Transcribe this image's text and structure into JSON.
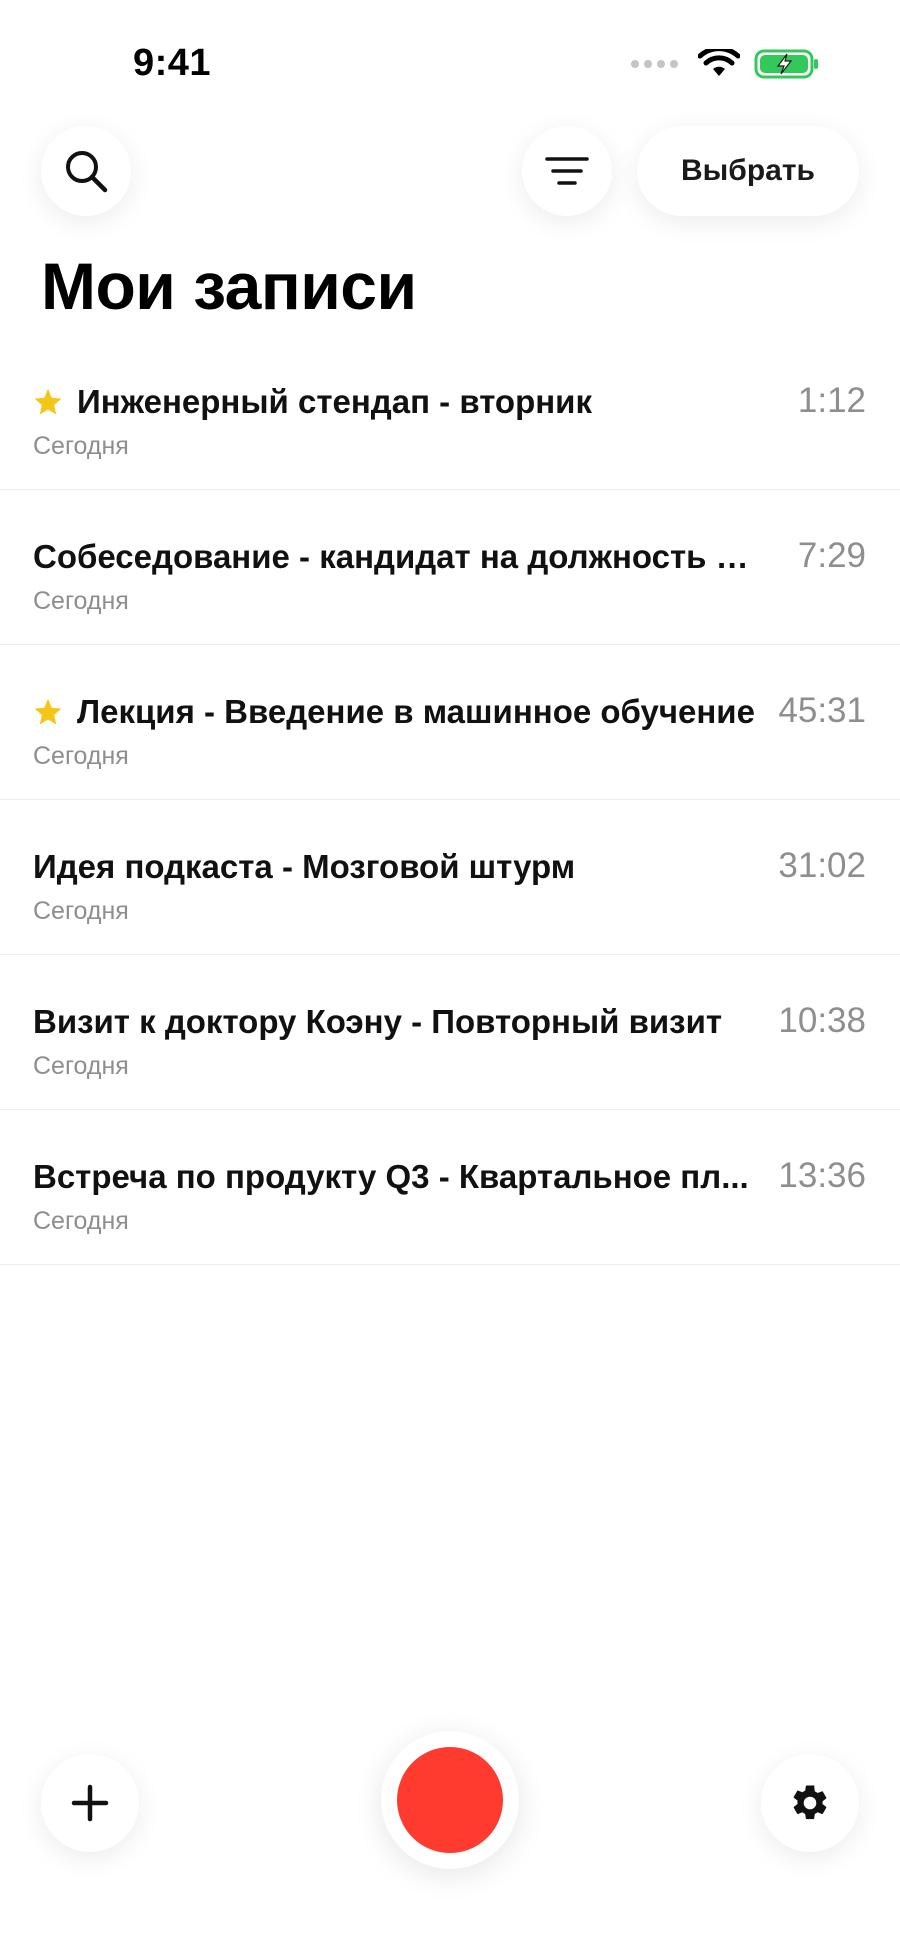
{
  "status_bar": {
    "time": "9:41"
  },
  "header": {
    "select_label": "Выбрать",
    "title": "Мои записи"
  },
  "icons": {
    "search": "search-icon",
    "filter": "filter-icon",
    "star": "star-icon",
    "add": "plus-icon",
    "settings": "gear-icon",
    "record": "record-icon",
    "wifi": "wifi-icon",
    "battery": "battery-charging-icon"
  },
  "colors": {
    "star": "#F5C518",
    "record": "#FF3B30",
    "battery": "#34C759",
    "secondary_text": "#8E8E8E"
  },
  "records": [
    {
      "title": "Инженерный стендап - вторник",
      "date": "Сегодня",
      "duration": "1:12",
      "starred": true
    },
    {
      "title": "Собеседование - кандидат на должность Ва...",
      "date": "Сегодня",
      "duration": "7:29",
      "starred": false
    },
    {
      "title": "Лекция - Введение в машинное обучение",
      "date": "Сегодня",
      "duration": "45:31",
      "starred": true
    },
    {
      "title": "Идея подкаста - Мозговой штурм",
      "date": "Сегодня",
      "duration": "31:02",
      "starred": false
    },
    {
      "title": "Визит к доктору Коэну - Повторный визит",
      "date": "Сегодня",
      "duration": "10:38",
      "starred": false
    },
    {
      "title": "Встреча по продукту Q3 - Квартальное пл...",
      "date": "Сегодня",
      "duration": "13:36",
      "starred": false
    }
  ]
}
